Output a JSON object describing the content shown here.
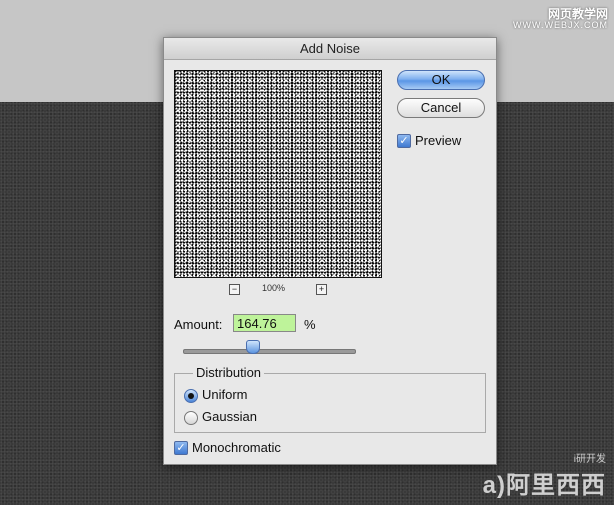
{
  "watermark_top": {
    "line1": "网页教学网",
    "line2": "WWW.WEBJX.COM"
  },
  "dialog": {
    "title": "Add Noise",
    "ok_label": "OK",
    "cancel_label": "Cancel",
    "preview": {
      "label": "Preview",
      "checked": true
    },
    "zoom": {
      "minus": "−",
      "plus": "+",
      "level": "100%"
    },
    "amount": {
      "label": "Amount:",
      "value": "164.76",
      "unit": "%"
    },
    "distribution": {
      "title": "Distribution",
      "options": [
        {
          "label": "Uniform",
          "selected": true
        },
        {
          "label": "Gaussian",
          "selected": false
        }
      ]
    },
    "monochromatic": {
      "label": "Monochromatic",
      "checked": true
    }
  },
  "watermark_bottom": {
    "small": "i研开发",
    "brand": "a)阿里西西"
  },
  "colors": {
    "dialog_bg": "#e8e8e8",
    "amount_field": "#bef39a",
    "primary_button": "#5a96e6"
  }
}
